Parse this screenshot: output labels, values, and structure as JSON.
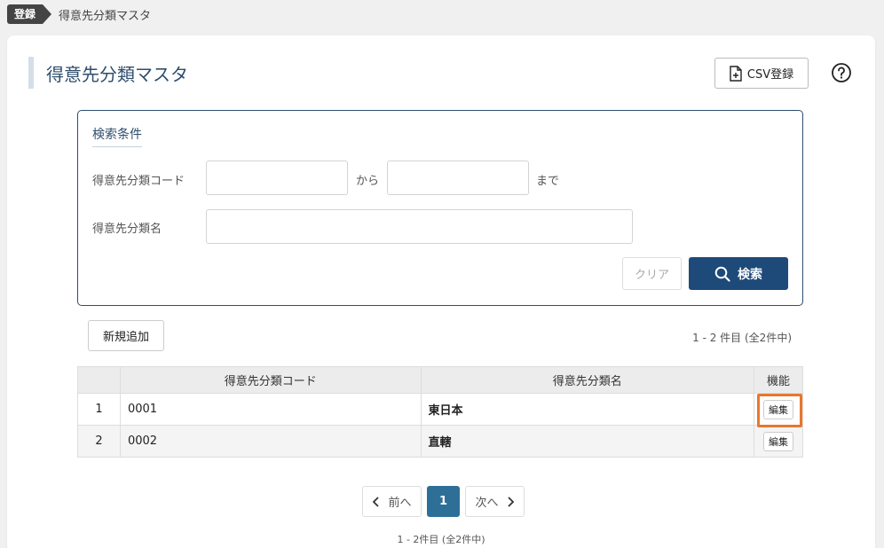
{
  "breadcrumb": {
    "tag": "登録",
    "current": "得意先分類マスタ"
  },
  "page_title": "得意先分類マスタ",
  "csv_button_label": "CSV登録",
  "search": {
    "heading": "検索条件",
    "code_label": "得意先分類コード",
    "from_text": "から",
    "to_text": "まで",
    "name_label": "得意先分類名",
    "code_from_value": "",
    "code_to_value": "",
    "name_value": "",
    "clear_label": "クリア",
    "search_label": "検索"
  },
  "add_button_label": "新規追加",
  "count_text": "1 - 2 件目 (全2件中)",
  "table": {
    "headers": [
      "",
      "得意先分類コード",
      "得意先分類名",
      "機能"
    ],
    "rows": [
      {
        "num": "1",
        "code": "0001",
        "name": "東日本",
        "action": "編集"
      },
      {
        "num": "2",
        "code": "0002",
        "name": "直轄",
        "action": "編集"
      }
    ]
  },
  "pager": {
    "prev": "前へ",
    "current": "1",
    "next": "次へ"
  },
  "count_bottom": "1 - 2件目 (全2件中)",
  "colors": {
    "primary": "#1e4a7a",
    "title": "#2f4e6e",
    "highlight": "#e8772e",
    "page_current": "#2e6f98"
  }
}
